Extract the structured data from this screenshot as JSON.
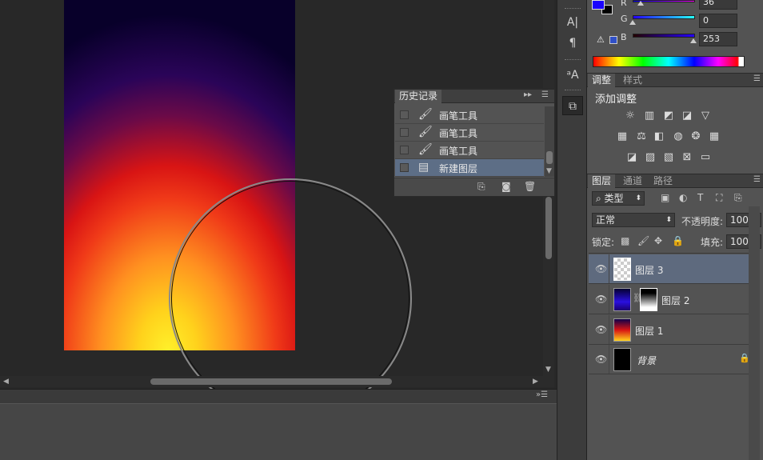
{
  "color_panel": {
    "r_label": "R",
    "g_label": "G",
    "b_label": "B",
    "r_value": "36",
    "g_value": "0",
    "b_value": "253",
    "fg_color": "#1a02fd",
    "bg_color": "#000000"
  },
  "adjustments": {
    "tabs": [
      "调整",
      "样式"
    ],
    "title": "添加调整"
  },
  "layers_panel": {
    "tabs": [
      "图层",
      "通道",
      "路径"
    ],
    "filter_label": "类型",
    "blend_mode": "正常",
    "opacity_label": "不透明度:",
    "opacity_value": "100%",
    "lock_label": "锁定:",
    "fill_label": "填充:",
    "fill_value": "100%",
    "layers": [
      {
        "name": "图层 3",
        "selected": true
      },
      {
        "name": "图层 2",
        "selected": false
      },
      {
        "name": "图层 1",
        "selected": false
      },
      {
        "name": "背景",
        "selected": false
      }
    ]
  },
  "history_panel": {
    "title": "历史记录",
    "items": [
      {
        "label": "画笔工具",
        "icon": "brush-icon"
      },
      {
        "label": "画笔工具",
        "icon": "brush-icon"
      },
      {
        "label": "画笔工具",
        "icon": "brush-icon"
      },
      {
        "label": "新建图层",
        "icon": "new-layer-icon",
        "selected": true
      }
    ]
  },
  "tools": [
    "character-panel-icon",
    "paragraph-panel-icon",
    "glyphs-icon",
    "properties-icon"
  ]
}
